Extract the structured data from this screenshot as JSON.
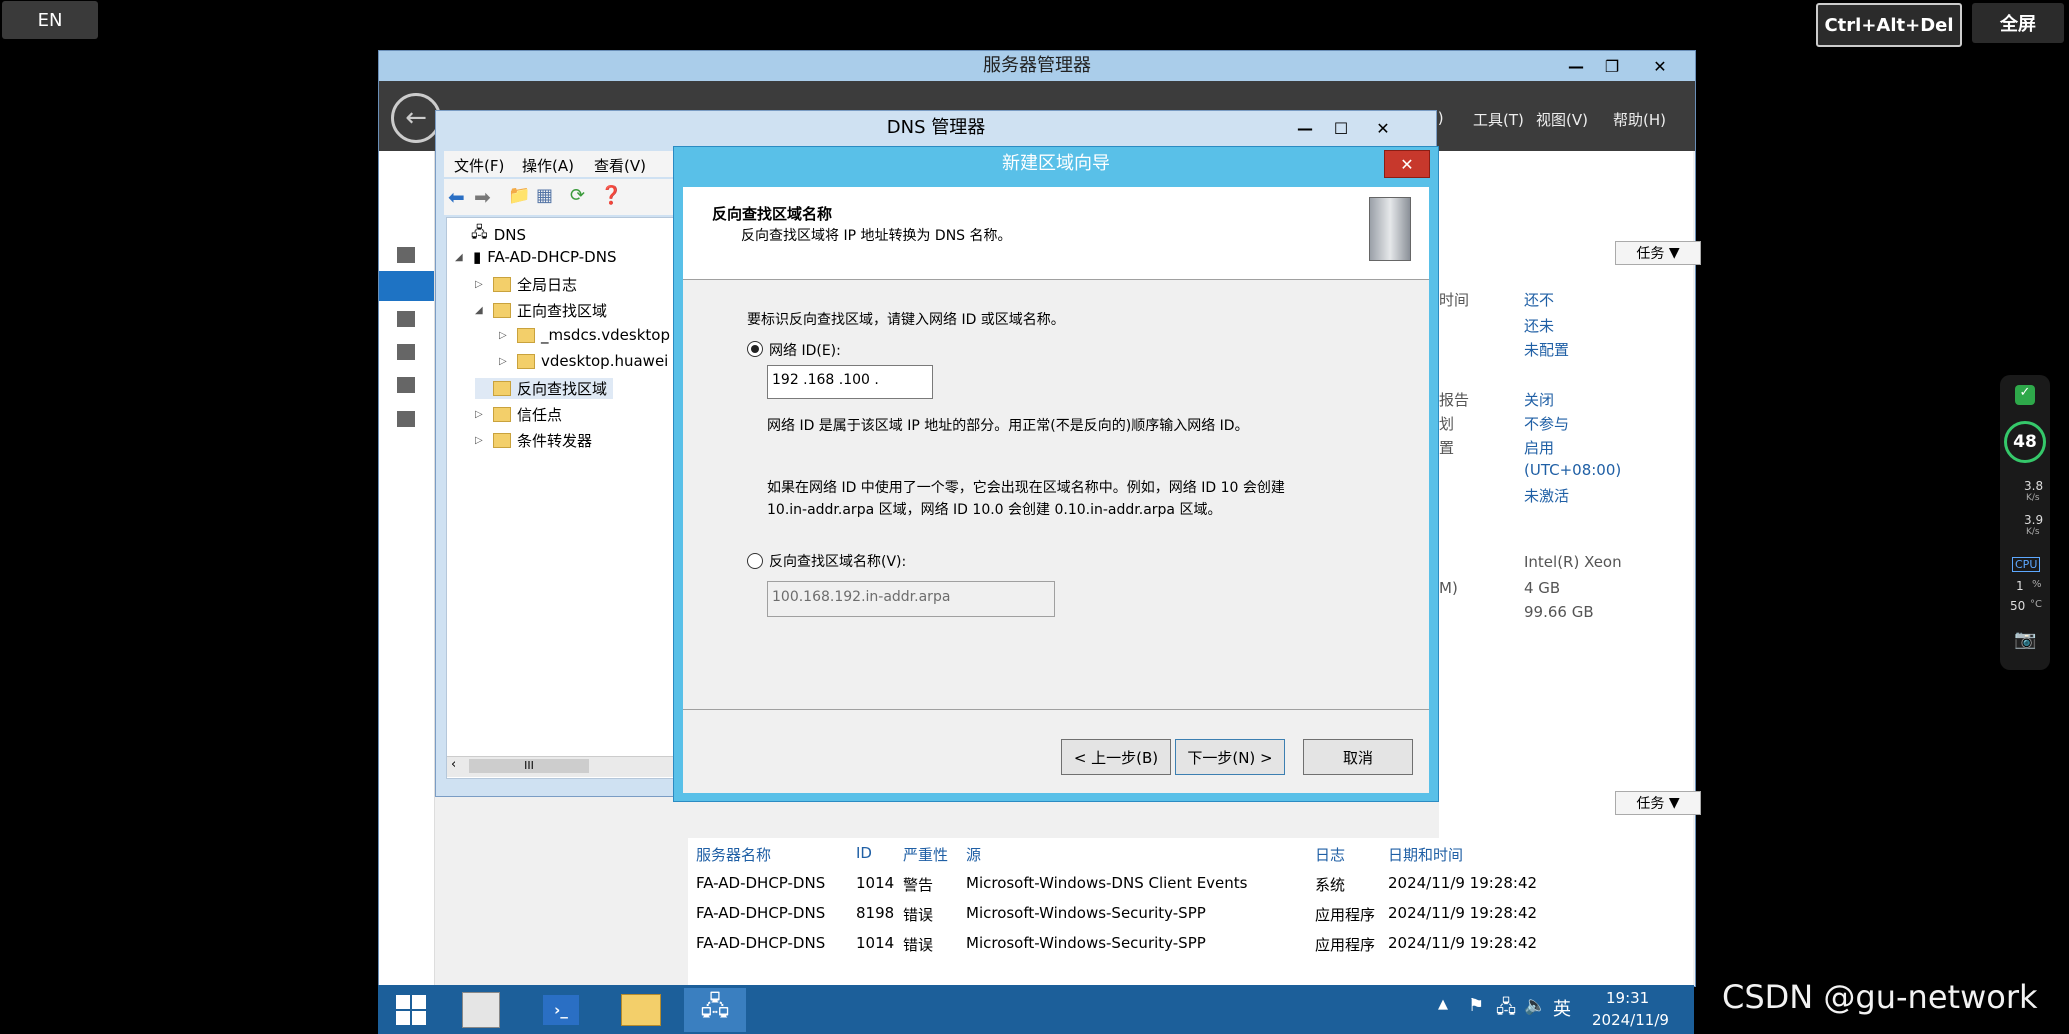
{
  "top_bar": {
    "lang": "EN",
    "ctrl_alt_del": "Ctrl+Alt+Del",
    "fullscreen": "全屏"
  },
  "server_manager": {
    "title": "服务器管理器",
    "menus": [
      "(M)",
      "工具(T)",
      "视图(V)",
      "帮助(H)"
    ],
    "tasks_label": "任务",
    "properties": [
      {
        "label": "时间",
        "value": "还不"
      },
      {
        "label": "",
        "value": "还未"
      },
      {
        "label": "",
        "value": "未配置"
      },
      {
        "label": "报告",
        "value": "关闭"
      },
      {
        "label": "划",
        "value": "不参与"
      },
      {
        "label": "置",
        "value": "启用"
      },
      {
        "label": "",
        "value": "(UTC+08:00)"
      },
      {
        "label": "",
        "value": "未激活"
      },
      {
        "label": "",
        "value": "Intel(R) Xeon"
      },
      {
        "label": "M)",
        "value": "4 GB"
      },
      {
        "label": "",
        "value": "99.66 GB"
      }
    ],
    "events": {
      "columns": [
        "服务器名称",
        "ID",
        "严重性",
        "源",
        "日志",
        "日期和时间"
      ],
      "rows": [
        [
          "FA-AD-DHCP-DNS",
          "1014",
          "警告",
          "Microsoft-Windows-DNS Client Events",
          "系统",
          "2024/11/9 19:28:42"
        ],
        [
          "FA-AD-DHCP-DNS",
          "8198",
          "错误",
          "Microsoft-Windows-Security-SPP",
          "应用程序",
          "2024/11/9 19:28:42"
        ],
        [
          "FA-AD-DHCP-DNS",
          "1014",
          "错误",
          "Microsoft-Windows-Security-SPP",
          "应用程序",
          "2024/11/9 19:28:42"
        ]
      ]
    }
  },
  "dns_manager": {
    "title": "DNS 管理器",
    "menus": [
      "文件(F)",
      "操作(A)",
      "查看(V)"
    ],
    "tree": [
      {
        "label": "DNS",
        "level": 0
      },
      {
        "label": "FA-AD-DHCP-DNS",
        "level": 1
      },
      {
        "label": "全局日志",
        "level": 2
      },
      {
        "label": "正向查找区域",
        "level": 2
      },
      {
        "label": "_msdcs.vdesktop",
        "level": 3
      },
      {
        "label": "vdesktop.huawei",
        "level": 3
      },
      {
        "label": "反向查找区域",
        "level": 2
      },
      {
        "label": "信任点",
        "level": 2
      },
      {
        "label": "条件转发器",
        "level": 2
      }
    ],
    "scroll_label": "III"
  },
  "wizard": {
    "title": "新建区域向导",
    "close": "✕",
    "header_title": "反向查找区域名称",
    "header_sub": "反向查找区域将 IP 地址转换为 DNS 名称。",
    "instruction": "要标识反向查找区域，请键入网络 ID 或区域名称。",
    "opt_network_id": "网络 ID(E):",
    "network_id_value": "192 .168 .100 .",
    "network_desc": "网络 ID 是属于该区域 IP 地址的部分。用正常(不是反向的)顺序输入网络 ID。",
    "zero_note_1": "如果在网络 ID 中使用了一个零，它会出现在区域名称中。例如，网络 ID 10 会创建",
    "zero_note_2": "10.in-addr.arpa 区域，网络 ID 10.0 会创建 0.10.in-addr.arpa 区域。",
    "opt_zone_name": "反向查找区域名称(V):",
    "zone_name_value": "100.168.192.in-addr.arpa",
    "back": "< 上一步(B)",
    "next": "下一步(N) >",
    "cancel": "取消"
  },
  "taskbar": {
    "time": "19:31",
    "date": "2024/11/9",
    "ime": "英"
  },
  "widget": {
    "score": "48",
    "up": "3.8",
    "up_unit": "K/s",
    "down": "3.9",
    "down_unit": "K/s",
    "cpu": "CPU",
    "cpu_val": "1",
    "cpu_pct": "%",
    "temp": "50",
    "temp_unit": "°C"
  },
  "watermark": "CSDN @gu-network"
}
